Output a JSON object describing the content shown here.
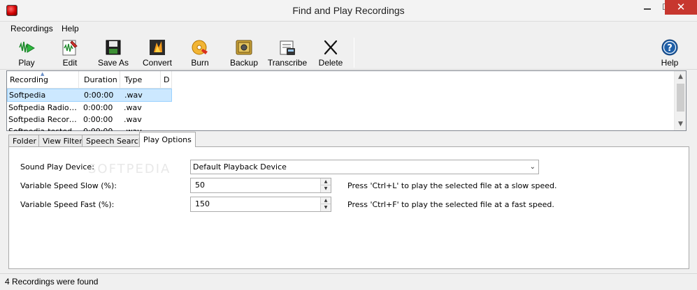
{
  "window": {
    "title": "Find and Play Recordings"
  },
  "menu": [
    "Recordings",
    "Help"
  ],
  "toolbar": {
    "buttons": [
      {
        "id": "play",
        "label": "Play",
        "icon": "play-waveform-icon"
      },
      {
        "id": "edit",
        "label": "Edit",
        "icon": "edit-waveform-icon"
      },
      {
        "id": "save_as",
        "label": "Save As",
        "icon": "floppy-disk-icon"
      },
      {
        "id": "convert",
        "label": "Convert",
        "icon": "convert-icon"
      },
      {
        "id": "burn",
        "label": "Burn",
        "icon": "cd-burn-icon"
      },
      {
        "id": "backup",
        "label": "Backup",
        "icon": "safe-icon"
      },
      {
        "id": "transcribe",
        "label": "Transcribe",
        "icon": "transcribe-icon"
      },
      {
        "id": "delete",
        "label": "Delete",
        "icon": "delete-x-icon"
      }
    ],
    "help_label": "Help"
  },
  "recordings": {
    "columns": [
      "Recording",
      "Duration",
      "Type",
      "D"
    ],
    "rows": [
      {
        "name": "Softpedia",
        "duration": "0:00:00",
        "type": ".wav",
        "selected": true
      },
      {
        "name": "Softpedia Radio-vr",
        "duration": "0:00:00",
        "type": ".wav",
        "selected": false
      },
      {
        "name": "Softpedia Recordin...",
        "duration": "0:00:00",
        "type": ".wav",
        "selected": false
      },
      {
        "name": "Softpedia-tested",
        "duration": "0:00:00",
        "type": ".wav",
        "selected": false
      }
    ]
  },
  "tabs": [
    "Folder",
    "View Filter",
    "Speech Search",
    "Play Options"
  ],
  "active_tab": "Play Options",
  "play_options": {
    "sound_device_label": "Sound Play Device:",
    "sound_device_value": "Default Playback Device",
    "slow_label": "Variable Speed Slow (%):",
    "slow_value": "50",
    "slow_hint": "Press 'Ctrl+L' to play the selected file at a slow speed.",
    "fast_label": "Variable Speed Fast (%):",
    "fast_value": "150",
    "fast_hint": "Press 'Ctrl+F' to play the selected file at a fast speed.",
    "watermark": "SOFTPEDIA"
  },
  "status": {
    "text": "4 Recordings were found"
  },
  "colors": {
    "selection_bg": "#cce8ff",
    "close_button": "#c7372f",
    "accent_blue": "#1e5fa8"
  }
}
